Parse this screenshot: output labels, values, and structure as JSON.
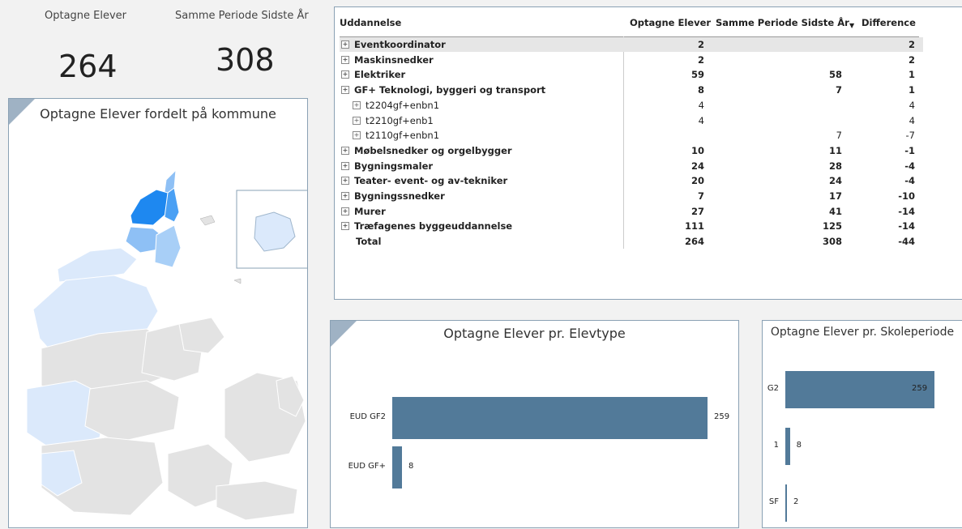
{
  "kpis": {
    "optagne_label": "Optagne Elever",
    "optagne_value": "264",
    "samme_label": "Samme Periode Sidste År",
    "samme_value": "308"
  },
  "map": {
    "title": "Optagne Elever fordelt på kommune"
  },
  "table": {
    "headers": [
      "Uddannelse",
      "Optagne Elever",
      "Samme Periode Sidste År",
      "Difference"
    ],
    "rows": [
      {
        "name": "Eventkoordinator",
        "a": "2",
        "b": "",
        "d": "2",
        "level": 0,
        "bold": true
      },
      {
        "name": "Maskinsnedker",
        "a": "2",
        "b": "",
        "d": "2",
        "level": 0,
        "bold": true
      },
      {
        "name": "Elektriker",
        "a": "59",
        "b": "58",
        "d": "1",
        "level": 0,
        "bold": true
      },
      {
        "name": "GF+ Teknologi, byggeri og transport",
        "a": "8",
        "b": "7",
        "d": "1",
        "level": 0,
        "bold": true
      },
      {
        "name": "t2204gf+enbn1",
        "a": "4",
        "b": "",
        "d": "4",
        "level": 1,
        "bold": false
      },
      {
        "name": "t2210gf+enb1",
        "a": "4",
        "b": "",
        "d": "4",
        "level": 1,
        "bold": false
      },
      {
        "name": "t2110gf+enbn1",
        "a": "",
        "b": "7",
        "d": "-7",
        "level": 1,
        "bold": false
      },
      {
        "name": "Møbelsnedker og orgelbygger",
        "a": "10",
        "b": "11",
        "d": "-1",
        "level": 0,
        "bold": true
      },
      {
        "name": "Bygningsmaler",
        "a": "24",
        "b": "28",
        "d": "-4",
        "level": 0,
        "bold": true
      },
      {
        "name": "Teater- event- og av-tekniker",
        "a": "20",
        "b": "24",
        "d": "-4",
        "level": 0,
        "bold": true
      },
      {
        "name": "Bygningssnedker",
        "a": "7",
        "b": "17",
        "d": "-10",
        "level": 0,
        "bold": true
      },
      {
        "name": "Murer",
        "a": "27",
        "b": "41",
        "d": "-14",
        "level": 0,
        "bold": true
      },
      {
        "name": "Træfagenes byggeuddannelse",
        "a": "111",
        "b": "125",
        "d": "-14",
        "level": 0,
        "bold": true
      },
      {
        "name": "Total",
        "a": "264",
        "b": "308",
        "d": "-44",
        "level": 0,
        "bold": true,
        "total": true
      }
    ]
  },
  "colors": {
    "bar": "#527a99",
    "map_high": "#1e88f0",
    "map_mid": "#8ec0f5",
    "map_low": "#dbe9fb",
    "map_none": "#e3e3e3"
  },
  "chart_data": [
    {
      "type": "bar",
      "title": "Optagne Elever pr. Elevtype",
      "categories": [
        "EUD GF2",
        "EUD GF+"
      ],
      "values": [
        259,
        8
      ],
      "orientation": "horizontal"
    },
    {
      "type": "bar",
      "title": "Optagne Elever pr. Skoleperiode",
      "categories": [
        "G2",
        "1",
        "SF"
      ],
      "values": [
        259,
        8,
        2
      ],
      "orientation": "horizontal"
    }
  ]
}
